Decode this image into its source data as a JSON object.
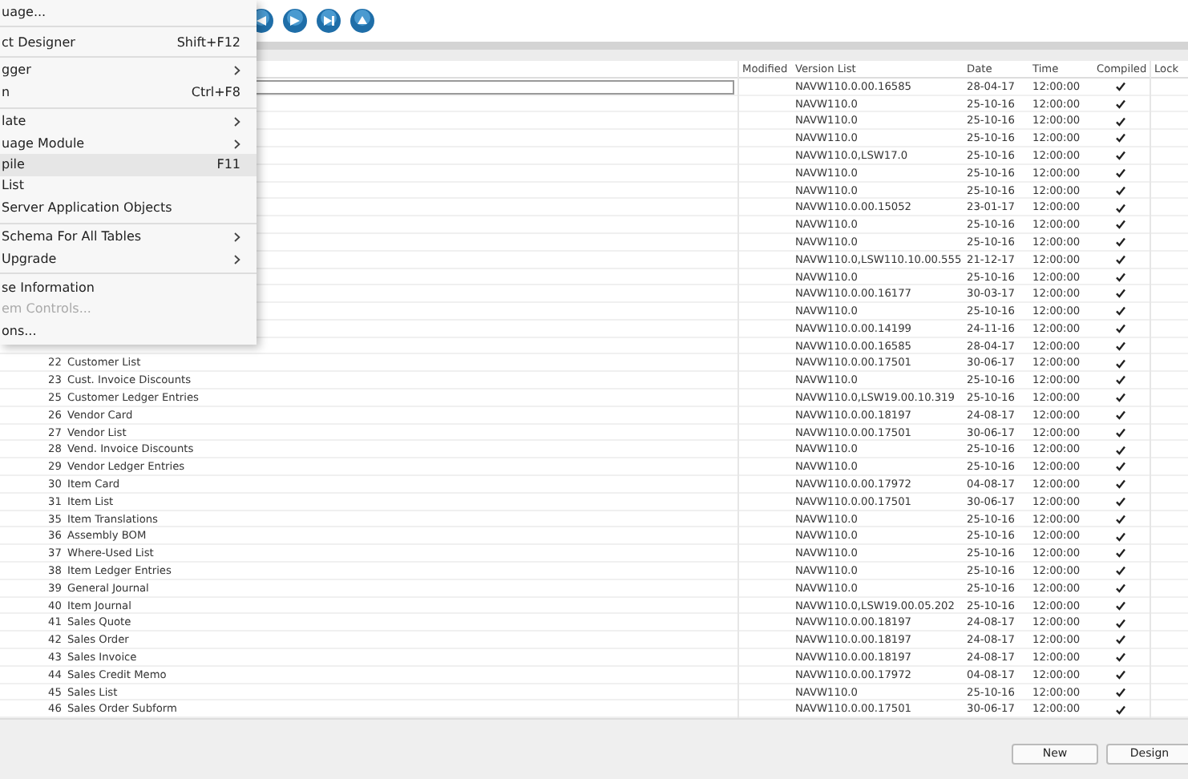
{
  "menu": {
    "items": [
      {
        "label": "uage...",
        "submenu": false,
        "highlighted": false,
        "disabled": false,
        "separator_after": true
      },
      {
        "label": "ct Designer",
        "shortcut": "Shift+F12",
        "submenu": false,
        "highlighted": false,
        "disabled": false,
        "separator_after": true
      },
      {
        "label": "gger",
        "submenu": true,
        "highlighted": false,
        "disabled": false,
        "separator_after": false
      },
      {
        "label": "n",
        "shortcut": "Ctrl+F8",
        "submenu": false,
        "highlighted": false,
        "disabled": false,
        "separator_after": true
      },
      {
        "label": "late",
        "submenu": true,
        "highlighted": false,
        "disabled": false,
        "separator_after": false
      },
      {
        "label": "uage Module",
        "submenu": true,
        "highlighted": false,
        "disabled": false,
        "separator_after": false
      },
      {
        "label": "pile",
        "shortcut": "F11",
        "submenu": false,
        "highlighted": true,
        "disabled": false,
        "separator_after": false
      },
      {
        "label": "List",
        "submenu": false,
        "highlighted": false,
        "disabled": false,
        "separator_after": false
      },
      {
        "label": "Server Application Objects",
        "submenu": false,
        "highlighted": false,
        "disabled": false,
        "separator_after": true
      },
      {
        "label": "Schema For All Tables",
        "submenu": true,
        "highlighted": false,
        "disabled": false,
        "separator_after": false
      },
      {
        "label": "Upgrade",
        "submenu": true,
        "highlighted": false,
        "disabled": false,
        "separator_after": true
      },
      {
        "label": "se Information",
        "submenu": false,
        "highlighted": false,
        "disabled": false,
        "separator_after": false
      },
      {
        "label": "em Controls...",
        "submenu": false,
        "highlighted": false,
        "disabled": true,
        "separator_after": false
      },
      {
        "label": "ons...",
        "submenu": false,
        "highlighted": false,
        "disabled": false,
        "separator_after": false
      }
    ]
  },
  "table": {
    "columns": [
      "Modified",
      "Version List",
      "Date",
      "Time",
      "Compiled",
      "Lock"
    ],
    "rows": [
      {
        "editing": true,
        "version": "NAVW110.0.00.16585",
        "date": "28-04-17",
        "time": "12:00:00",
        "compiled": true
      },
      {
        "editing": false,
        "version": "NAVW110.0",
        "date": "25-10-16",
        "time": "12:00:00",
        "compiled": true
      },
      {
        "editing": false,
        "version": "NAVW110.0",
        "date": "25-10-16",
        "time": "12:00:00",
        "compiled": true
      },
      {
        "editing": false,
        "version": "NAVW110.0",
        "date": "25-10-16",
        "time": "12:00:00",
        "compiled": true
      },
      {
        "editing": false,
        "version": "NAVW110.0,LSW17.0",
        "date": "25-10-16",
        "time": "12:00:00",
        "compiled": true
      },
      {
        "editing": false,
        "version": "NAVW110.0",
        "date": "25-10-16",
        "time": "12:00:00",
        "compiled": true
      },
      {
        "editing": false,
        "version": "NAVW110.0",
        "date": "25-10-16",
        "time": "12:00:00",
        "compiled": true
      },
      {
        "editing": false,
        "version": "NAVW110.0.00.15052",
        "date": "23-01-17",
        "time": "12:00:00",
        "compiled": true
      },
      {
        "editing": false,
        "version": "NAVW110.0",
        "date": "25-10-16",
        "time": "12:00:00",
        "compiled": true
      },
      {
        "editing": false,
        "version": "NAVW110.0",
        "date": "25-10-16",
        "time": "12:00:00",
        "compiled": true
      },
      {
        "editing": false,
        "version": "NAVW110.0,LSW110.10.00.555",
        "date": "21-12-17",
        "time": "12:00:00",
        "compiled": true
      },
      {
        "editing": false,
        "version": "NAVW110.0",
        "date": "25-10-16",
        "time": "12:00:00",
        "compiled": true
      },
      {
        "editing": false,
        "version": "NAVW110.0.00.16177",
        "date": "30-03-17",
        "time": "12:00:00",
        "compiled": true
      },
      {
        "editing": false,
        "version": "NAVW110.0",
        "date": "25-10-16",
        "time": "12:00:00",
        "compiled": true
      },
      {
        "editing": false,
        "version": "NAVW110.0.00.14199",
        "date": "24-11-16",
        "time": "12:00:00",
        "compiled": true
      },
      {
        "editing": false,
        "version": "NAVW110.0.00.16585",
        "date": "28-04-17",
        "time": "12:00:00",
        "compiled": true
      },
      {
        "id": "22",
        "name": "Customer List",
        "editing": false,
        "version": "NAVW110.0.00.17501",
        "date": "30-06-17",
        "time": "12:00:00",
        "compiled": true
      },
      {
        "id": "23",
        "name": "Cust. Invoice Discounts",
        "editing": false,
        "version": "NAVW110.0",
        "date": "25-10-16",
        "time": "12:00:00",
        "compiled": true
      },
      {
        "id": "25",
        "name": "Customer Ledger Entries",
        "editing": false,
        "version": "NAVW110.0,LSW19.00.10.319",
        "date": "25-10-16",
        "time": "12:00:00",
        "compiled": true
      },
      {
        "id": "26",
        "name": "Vendor Card",
        "editing": false,
        "version": "NAVW110.0.00.18197",
        "date": "24-08-17",
        "time": "12:00:00",
        "compiled": true
      },
      {
        "id": "27",
        "name": "Vendor List",
        "editing": false,
        "version": "NAVW110.0.00.17501",
        "date": "30-06-17",
        "time": "12:00:00",
        "compiled": true
      },
      {
        "id": "28",
        "name": "Vend. Invoice Discounts",
        "editing": false,
        "version": "NAVW110.0",
        "date": "25-10-16",
        "time": "12:00:00",
        "compiled": true
      },
      {
        "id": "29",
        "name": "Vendor Ledger Entries",
        "editing": false,
        "version": "NAVW110.0",
        "date": "25-10-16",
        "time": "12:00:00",
        "compiled": true
      },
      {
        "id": "30",
        "name": "Item Card",
        "editing": false,
        "version": "NAVW110.0.00.17972",
        "date": "04-08-17",
        "time": "12:00:00",
        "compiled": true
      },
      {
        "id": "31",
        "name": "Item List",
        "editing": false,
        "version": "NAVW110.0.00.17501",
        "date": "30-06-17",
        "time": "12:00:00",
        "compiled": true
      },
      {
        "id": "35",
        "name": "Item Translations",
        "editing": false,
        "version": "NAVW110.0",
        "date": "25-10-16",
        "time": "12:00:00",
        "compiled": true
      },
      {
        "id": "36",
        "name": "Assembly BOM",
        "editing": false,
        "version": "NAVW110.0",
        "date": "25-10-16",
        "time": "12:00:00",
        "compiled": true
      },
      {
        "id": "37",
        "name": "Where-Used List",
        "editing": false,
        "version": "NAVW110.0",
        "date": "25-10-16",
        "time": "12:00:00",
        "compiled": true
      },
      {
        "id": "38",
        "name": "Item Ledger Entries",
        "editing": false,
        "version": "NAVW110.0",
        "date": "25-10-16",
        "time": "12:00:00",
        "compiled": true
      },
      {
        "id": "39",
        "name": "General Journal",
        "editing": false,
        "version": "NAVW110.0",
        "date": "25-10-16",
        "time": "12:00:00",
        "compiled": true
      },
      {
        "id": "40",
        "name": "Item Journal",
        "editing": false,
        "version": "NAVW110.0,LSW19.00.05.202",
        "date": "25-10-16",
        "time": "12:00:00",
        "compiled": true
      },
      {
        "id": "41",
        "name": "Sales Quote",
        "editing": false,
        "version": "NAVW110.0.00.18197",
        "date": "24-08-17",
        "time": "12:00:00",
        "compiled": true
      },
      {
        "id": "42",
        "name": "Sales Order",
        "editing": false,
        "version": "NAVW110.0.00.18197",
        "date": "24-08-17",
        "time": "12:00:00",
        "compiled": true
      },
      {
        "id": "43",
        "name": "Sales Invoice",
        "editing": false,
        "version": "NAVW110.0.00.18197",
        "date": "24-08-17",
        "time": "12:00:00",
        "compiled": true
      },
      {
        "id": "44",
        "name": "Sales Credit Memo",
        "editing": false,
        "version": "NAVW110.0.00.17972",
        "date": "04-08-17",
        "time": "12:00:00",
        "compiled": true
      },
      {
        "id": "45",
        "name": "Sales List",
        "editing": false,
        "version": "NAVW110.0",
        "date": "25-10-16",
        "time": "12:00:00",
        "compiled": true
      },
      {
        "id": "46",
        "name": "Sales Order Subform",
        "editing": false,
        "version": "NAVW110.0.00.17501",
        "date": "30-06-17",
        "time": "12:00:00",
        "compiled": true
      }
    ]
  },
  "buttons": [
    "New",
    "Design"
  ]
}
